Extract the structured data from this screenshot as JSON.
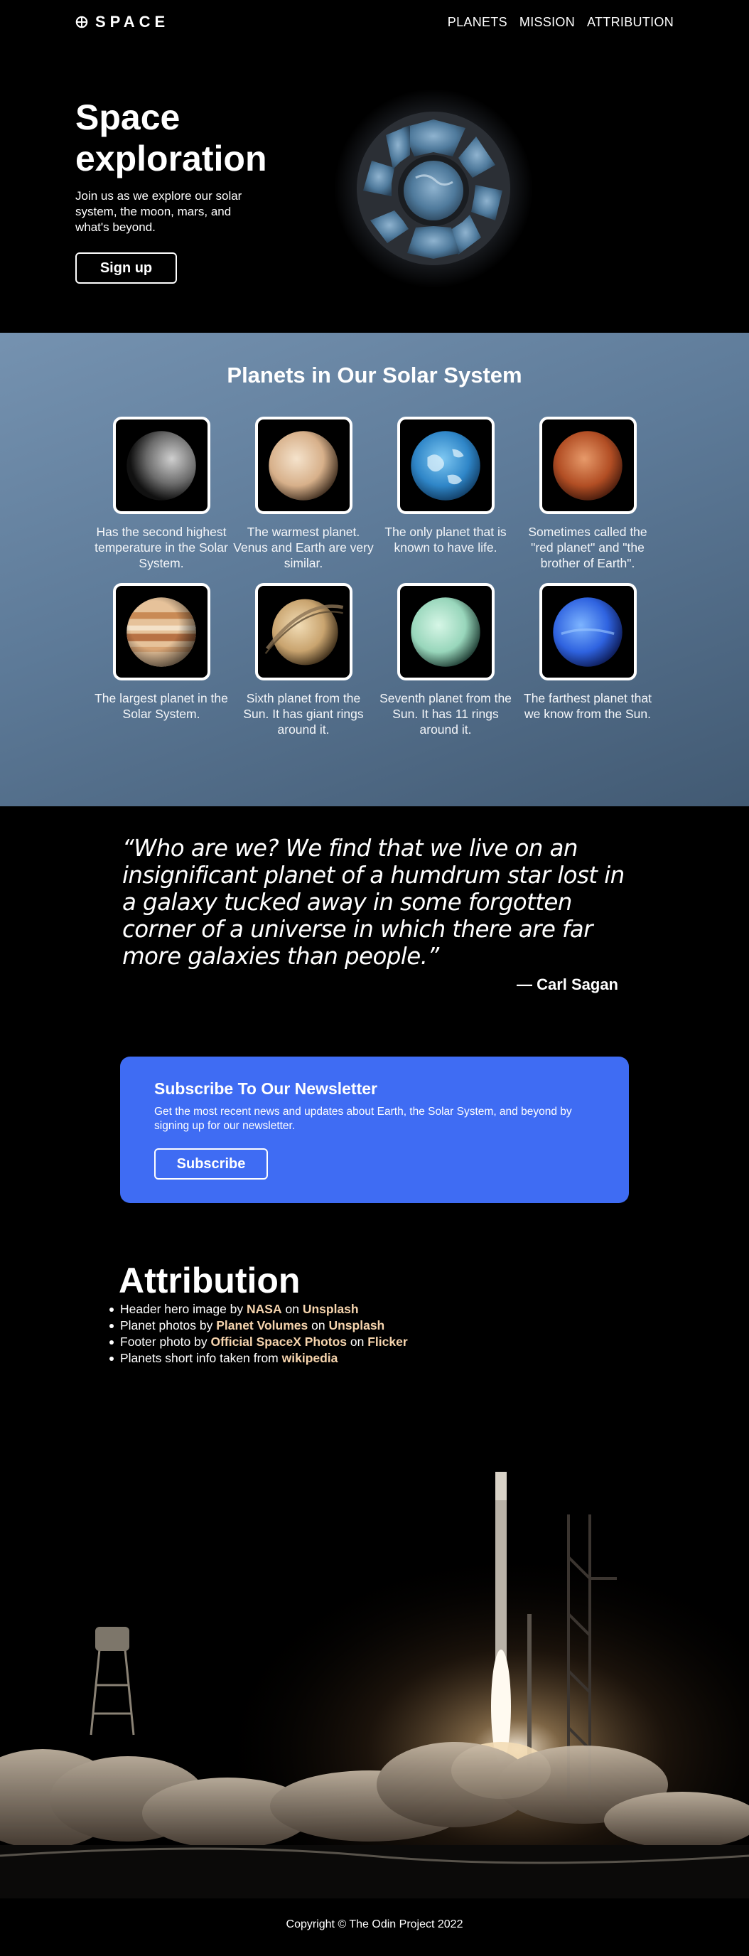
{
  "nav": {
    "logo_text": "SPACE",
    "links": [
      "PLANETS",
      "MISSION",
      "ATTRIBUTION"
    ]
  },
  "hero": {
    "title": "Space exploration",
    "text": "Join us as we explore our solar system, the moon, mars, and what's beyond.",
    "button_label": "Sign up"
  },
  "planets": {
    "title": "Planets in Our Solar System",
    "items": [
      {
        "icon": "mercury-planet-image",
        "description": "Has the second highest temperature in the Solar System."
      },
      {
        "icon": "venus-planet-image",
        "description": "The warmest planet. Venus and Earth are very similar."
      },
      {
        "icon": "earth-planet-image",
        "description": "The only planet that is known to have life."
      },
      {
        "icon": "mars-planet-image",
        "description": "Sometimes called the \"red planet\" and \"the brother of Earth\"."
      },
      {
        "icon": "jupiter-planet-image",
        "description": "The largest planet in the Solar System."
      },
      {
        "icon": "saturn-planet-image",
        "description": "Sixth planet from the Sun. It has giant rings around it."
      },
      {
        "icon": "uranus-planet-image",
        "description": "Seventh planet from the Sun. It has 11 rings around it."
      },
      {
        "icon": "neptune-planet-image",
        "description": "The farthest planet that we know from the Sun."
      }
    ]
  },
  "quote": {
    "text": "“Who are we? We find that we live on an insignificant planet of a humdrum star lost in a galaxy tucked away in some forgotten corner of a universe in which there are far more galaxies than people.”",
    "author": "— Carl Sagan"
  },
  "newsletter": {
    "title": "Subscribe To Our Newsletter",
    "text": "Get the most recent news and updates about Earth, the Solar System, and beyond by signing up for our newsletter.",
    "button_label": "Subscribe"
  },
  "attribution": {
    "title": "Attribution",
    "items": [
      {
        "prefix": "Header hero image by ",
        "link1": "NASA",
        "middle": " on ",
        "link2": "Unsplash"
      },
      {
        "prefix": "Planet photos by ",
        "link1": "Planet Volumes",
        "middle": " on ",
        "link2": "Unsplash"
      },
      {
        "prefix": "Footer photo by ",
        "link1": "Official SpaceX Photos",
        "middle": " on ",
        "link2": "Flicker"
      },
      {
        "prefix": "Planets short info taken from ",
        "link1": "wikipedia",
        "middle": "",
        "link2": ""
      }
    ]
  },
  "footer": {
    "copyright": "Copyright © The Odin Project 2022"
  },
  "colors": {
    "accent": "#3f6cf3",
    "link_highlight": "#f6d4ad",
    "background": "#000000"
  }
}
